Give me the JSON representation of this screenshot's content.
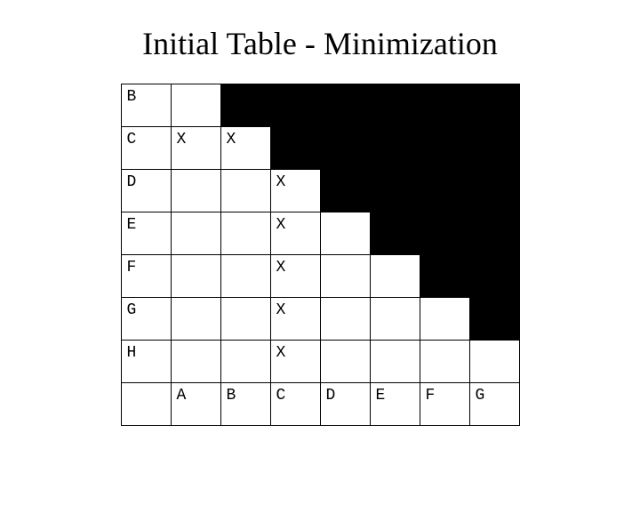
{
  "title": "Initial Table - Minimization",
  "rows": {
    "B": {
      "label": "B"
    },
    "C": {
      "label": "C",
      "c0": "X",
      "c1": "X"
    },
    "D": {
      "label": "D",
      "c2": "X"
    },
    "E": {
      "label": "E",
      "c2": "X"
    },
    "F": {
      "label": "F",
      "c2": "X"
    },
    "G": {
      "label": "G",
      "c2": "X"
    },
    "H": {
      "label": "H",
      "c2": "X"
    }
  },
  "cols": {
    "A": "A",
    "B": "B",
    "C": "C",
    "D": "D",
    "E": "E",
    "F": "F",
    "G": "G"
  },
  "chart_data": {
    "type": "table",
    "title": "Initial Table - Minimization",
    "row_labels": [
      "B",
      "C",
      "D",
      "E",
      "F",
      "G",
      "H"
    ],
    "col_labels": [
      "A",
      "B",
      "C",
      "D",
      "E",
      "F",
      "G"
    ],
    "marks": [
      {
        "row": "C",
        "col": "A",
        "value": "X"
      },
      {
        "row": "C",
        "col": "B",
        "value": "X"
      },
      {
        "row": "D",
        "col": "C",
        "value": "X"
      },
      {
        "row": "E",
        "col": "C",
        "value": "X"
      },
      {
        "row": "F",
        "col": "C",
        "value": "X"
      },
      {
        "row": "G",
        "col": "C",
        "value": "X"
      },
      {
        "row": "H",
        "col": "C",
        "value": "X"
      }
    ],
    "blocked_cells": [
      {
        "row": "B",
        "cols": [
          "B",
          "C",
          "D",
          "E",
          "F",
          "G"
        ]
      },
      {
        "row": "C",
        "cols": [
          "C",
          "D",
          "E",
          "F",
          "G"
        ]
      },
      {
        "row": "D",
        "cols": [
          "D",
          "E",
          "F",
          "G"
        ]
      },
      {
        "row": "E",
        "cols": [
          "E",
          "F",
          "G"
        ]
      },
      {
        "row": "F",
        "cols": [
          "F",
          "G"
        ]
      },
      {
        "row": "G",
        "cols": [
          "G"
        ]
      }
    ]
  }
}
